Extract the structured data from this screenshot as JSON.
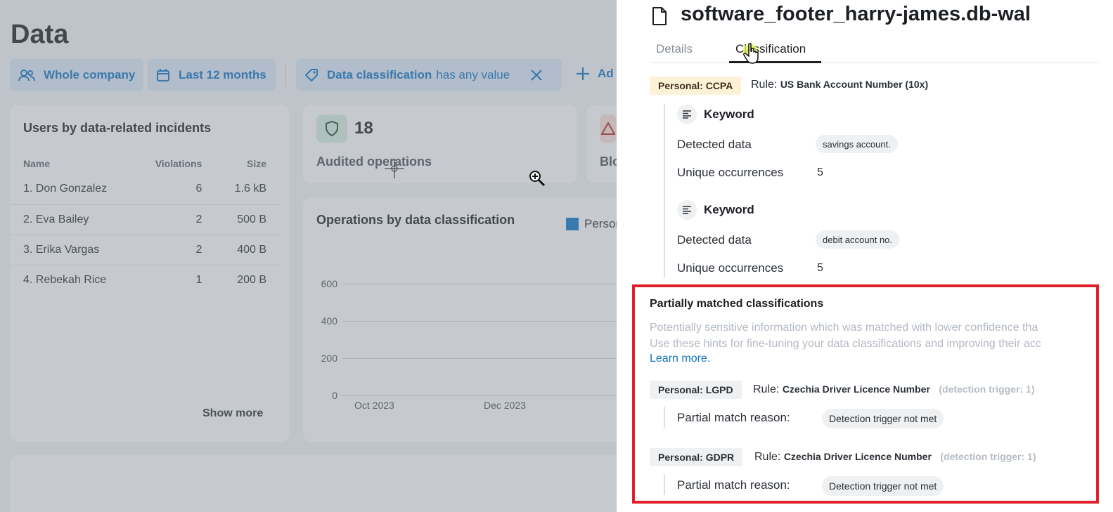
{
  "dashboard": {
    "title": "Data",
    "filters": {
      "company": "Whole company",
      "period": "Last 12 months",
      "classification_label": "Data classification",
      "classification_value": "has any value",
      "add": "Ad"
    },
    "users_card": {
      "title": "Users by data-related incidents",
      "headers": [
        "Name",
        "Violations",
        "Size"
      ],
      "rows": [
        {
          "name": "1. Don Gonzalez",
          "violations": "6",
          "size": "1.6 kB"
        },
        {
          "name": "2. Eva Bailey",
          "violations": "2",
          "size": "500 B"
        },
        {
          "name": "3. Erika Vargas",
          "violations": "2",
          "size": "400 B"
        },
        {
          "name": "4. Rebekah Rice",
          "violations": "1",
          "size": "200 B"
        }
      ],
      "show_more": "Show more"
    },
    "audited": {
      "value": "18",
      "label": "Audited operations"
    },
    "blocked": {
      "label": "Blo"
    },
    "ops_chart": {
      "title": "Operations by data classification",
      "legend": "Person",
      "y_ticks": [
        "600",
        "400",
        "200",
        "0"
      ],
      "x_ticks": [
        "Oct 2023",
        "Dec 2023"
      ]
    }
  },
  "drawer": {
    "file_name": "software_footer_harry-james.db-wal",
    "tabs": [
      "Details",
      "Classification"
    ],
    "active_tab": "Classification",
    "match": {
      "badge": "Personal: CCPA",
      "rule_prefix": "Rule:",
      "rule_name": "US Bank Account Number (10x)",
      "keywords": [
        {
          "title": "Keyword",
          "detected_label": "Detected data",
          "detected_value": "savings account.",
          "unique_label": "Unique occurrences",
          "unique_value": "5"
        },
        {
          "title": "Keyword",
          "detected_label": "Detected data",
          "detected_value": "debit account no.",
          "unique_label": "Unique occurrences",
          "unique_value": "5"
        }
      ]
    },
    "partial": {
      "title": "Partially matched classifications",
      "desc_line1": "Potentially sensitive information which was matched with lower confidence tha",
      "desc_line2": "Use these hints for fine-tuning your data classifications and improving their acc",
      "learn_more": "Learn more.",
      "items": [
        {
          "badge": "Personal: LGPD",
          "rule_prefix": "Rule:",
          "rule_name": "Czechia Driver Licence Number",
          "trigger": "(detection trigger: 1)",
          "reason_label": "Partial match reason:",
          "reason": "Detection trigger not met"
        },
        {
          "badge": "Personal: GDPR",
          "rule_prefix": "Rule:",
          "rule_name": "Czechia Driver Licence Number",
          "trigger": "(detection trigger: 1)",
          "reason_label": "Partial match reason:",
          "reason": "Detection trigger not met"
        }
      ]
    }
  },
  "colors": {
    "accent": "#1173c6",
    "highlight": "#e0202a",
    "ccpa_badge": "#fdf1d6"
  }
}
